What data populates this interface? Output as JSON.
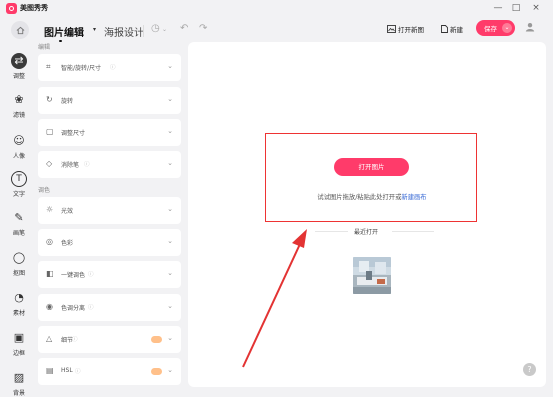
{
  "app": {
    "title": "美图秀秀"
  },
  "window_controls": {
    "minimize": "—",
    "maximize": "□",
    "close": "×"
  },
  "toolbar": {
    "tab_edit": "图片编辑",
    "tab_poster": "海报设计",
    "open_new": "打开新图",
    "new": "新建",
    "save": "保存"
  },
  "rail": [
    {
      "label": "调整",
      "icon": "adjust-icon",
      "glyph": "⇄",
      "active": true
    },
    {
      "label": "滤镜",
      "icon": "filter-icon",
      "glyph": "❀"
    },
    {
      "label": "人像",
      "icon": "portrait-icon",
      "glyph": "☺"
    },
    {
      "label": "文字",
      "icon": "text-icon",
      "glyph": "T"
    },
    {
      "label": "画笔",
      "icon": "brush-icon",
      "glyph": "✎"
    },
    {
      "label": "抠图",
      "icon": "cutout-icon",
      "glyph": "◯"
    },
    {
      "label": "素材",
      "icon": "sticker-icon",
      "glyph": "◔"
    },
    {
      "label": "边框",
      "icon": "frame-icon",
      "glyph": "▣"
    },
    {
      "label": "背景",
      "icon": "background-icon",
      "glyph": "▨"
    }
  ],
  "panel": {
    "section_edit": "编辑",
    "section_color": "调色",
    "tools": [
      {
        "label": "智能/旋转/尺寸",
        "icon": "crop-icon",
        "glyph": "⌗",
        "info": true
      },
      {
        "label": "旋转",
        "icon": "rotate-icon",
        "glyph": "↻"
      },
      {
        "label": "调整尺寸",
        "icon": "resize-icon",
        "glyph": "▢"
      },
      {
        "label": "消除笔",
        "icon": "eraser-icon",
        "glyph": "◇",
        "info": true
      },
      {
        "label": "光效",
        "icon": "light-icon",
        "glyph": "☼"
      },
      {
        "label": "色彩",
        "icon": "color-icon",
        "glyph": "◎"
      },
      {
        "label": "一键调色",
        "icon": "palette-icon",
        "glyph": "◧",
        "info": true
      },
      {
        "label": "色调分离",
        "icon": "split-tone-icon",
        "glyph": "◉",
        "info": true
      },
      {
        "label": "细节",
        "icon": "detail-icon",
        "glyph": "△",
        "info": true,
        "vip": true
      },
      {
        "label": "HSL",
        "icon": "hsl-icon",
        "glyph": "▤",
        "info": true,
        "vip": true
      }
    ]
  },
  "canvas": {
    "open_button": "打开图片",
    "hint": "试试图片拖放/粘贴此处打开或",
    "hint_link": "新建画布",
    "recent": "最近打开"
  },
  "colors": {
    "accent": "#ff3b6a",
    "highlight_box": "#e33333"
  }
}
